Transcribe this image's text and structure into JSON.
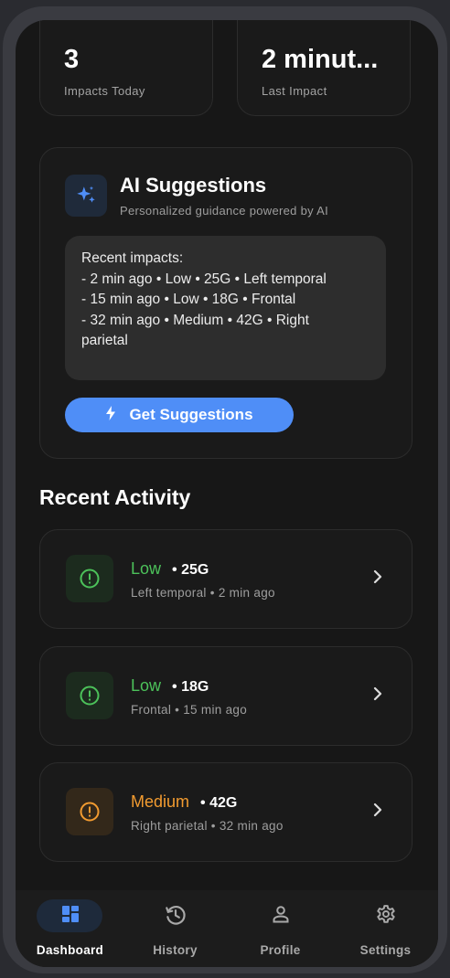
{
  "stats": [
    {
      "value": "3",
      "label": "Impacts Today"
    },
    {
      "value": "2 minut...",
      "label": "Last Impact"
    }
  ],
  "ai": {
    "title": "AI Suggestions",
    "subtitle": "Personalized guidance powered by AI",
    "lines": [
      "Recent impacts:",
      "- 2 min ago • Low • 25G • Left temporal",
      "- 15 min ago • Low • 18G • Frontal",
      "- 32 min ago • Medium • 42G • Right",
      "parietal"
    ],
    "button_label": "Get Suggestions",
    "icon": "sparkles-icon",
    "accent": "#4f8ef7"
  },
  "recent": {
    "title": "Recent Activity",
    "items": [
      {
        "level": "Low",
        "g": "• 25G",
        "detail": "Left temporal • 2 min ago",
        "color": "#4cc25a"
      },
      {
        "level": "Low",
        "g": "• 18G",
        "detail": "Frontal • 15 min ago",
        "color": "#4cc25a"
      },
      {
        "level": "Medium",
        "g": "• 42G",
        "detail": "Right parietal • 32 min ago",
        "color": "#f29b30"
      }
    ]
  },
  "nav": {
    "items": [
      {
        "label": "Dashboard",
        "icon": "dashboard-icon",
        "active": true
      },
      {
        "label": "History",
        "icon": "history-icon",
        "active": false
      },
      {
        "label": "Profile",
        "icon": "profile-icon",
        "active": false
      },
      {
        "label": "Settings",
        "icon": "gear-icon",
        "active": false
      }
    ]
  }
}
